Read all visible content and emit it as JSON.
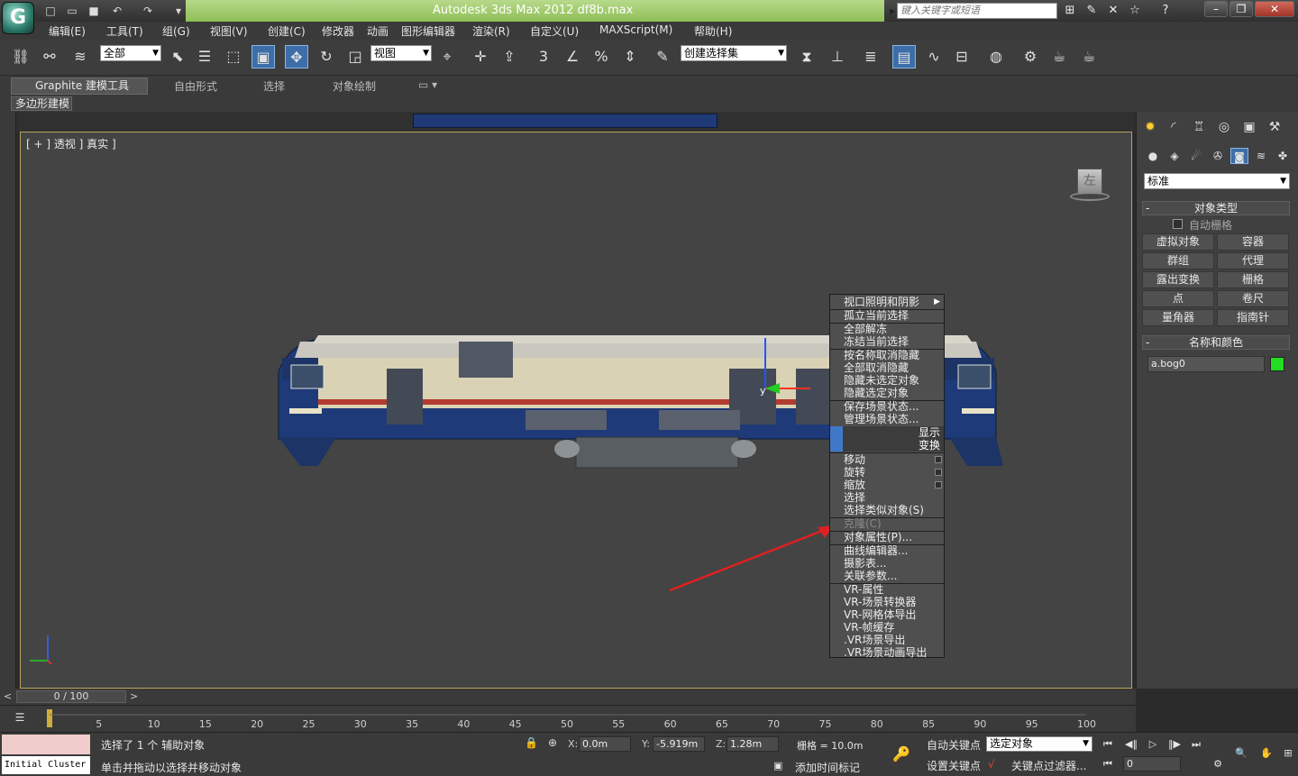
{
  "window": {
    "title": "Autodesk 3ds Max  2012        df8b.max",
    "search_placeholder": "键入关键字或短语",
    "logo_letter": "G",
    "colors": {
      "title_green": "#9ccb68",
      "accent_blue": "#3e6ea8",
      "viewport_bg": "#444444",
      "selection_color": "#22dd22"
    }
  },
  "menubar": {
    "items": [
      "编辑(E)",
      "工具(T)",
      "组(G)",
      "视图(V)",
      "创建(C)",
      "修改器",
      "动画",
      "图形编辑器",
      "渲染(R)",
      "自定义(U)",
      "MAXScript(M)",
      "帮助(H)"
    ]
  },
  "toolbar": {
    "selection_filter": "全部",
    "ref_coord": "视图",
    "named_selection": "创建选择集",
    "snap_labels": [
      "3",
      "%"
    ]
  },
  "ribbon": {
    "tabs": [
      "Graphite 建模工具",
      "自由形式",
      "选择",
      "对象绘制"
    ],
    "sub_label": "多边形建模"
  },
  "viewport": {
    "label": "[ + ] 透视 ] 真实 ]",
    "viewcube_face": "左",
    "axis_y": "y"
  },
  "context_menu": {
    "top_items": [
      "视口照明和阴影",
      "孤立当前选择",
      "全部解冻",
      "冻结当前选择",
      "按名称取消隐藏",
      "全部取消隐藏",
      "隐藏未选定对象",
      "隐藏选定对象",
      "保存场景状态...",
      "管理场景状态..."
    ],
    "quad_display": "显示",
    "quad_transform": "变换",
    "transform_items": [
      "移动",
      "旋转",
      "缩放",
      "选择",
      "选择类似对象(S)",
      "克隆(C)",
      "对象属性(P)...",
      "曲线编辑器...",
      "摄影表...",
      "关联参数..."
    ],
    "vr_items": [
      "VR-属性",
      "VR-场景转换器",
      "VR-网格体导出",
      "VR-帧缓存",
      ".VR场景导出",
      ".VR场景动画导出"
    ]
  },
  "command_panel": {
    "category": "标准",
    "object_type_title": "对象类型",
    "autogrid_label": "自动栅格",
    "buttons": [
      "虚拟对象",
      "容器",
      "群组",
      "代理",
      "露出变换",
      "栅格",
      "点",
      "卷尺",
      "量角器",
      "指南针"
    ],
    "name_color_title": "名称和颜色",
    "object_name": "a.bog0"
  },
  "timeline": {
    "frame_display": "0 / 100",
    "ticks": [
      "5",
      "10",
      "15",
      "20",
      "25",
      "30",
      "35",
      "40",
      "45",
      "50",
      "55",
      "60",
      "65",
      "70",
      "75",
      "80",
      "85",
      "90",
      "95",
      "100"
    ]
  },
  "statusbar": {
    "mini_listener": "Initial Cluster",
    "selection_status": "选择了 1 个 辅助对象",
    "prompt": "单击并拖动以选择并移动对象",
    "x_label": "X:",
    "x_value": "0.0m",
    "y_label": "Y:",
    "y_value": "-5.919m",
    "z_label": "Z:",
    "z_value": "1.28m",
    "grid": "栅格 = 10.0m",
    "add_time_tag": "添加时间标记",
    "auto_key": "自动关键点",
    "set_key": "设置关键点",
    "key_mode": "选定对象",
    "key_filters": "关键点过滤器...",
    "current_frame": "0"
  }
}
